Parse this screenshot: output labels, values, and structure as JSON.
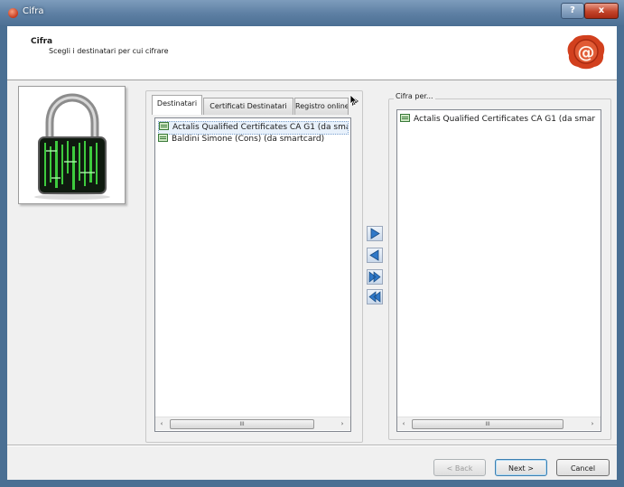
{
  "window": {
    "title": "Cifra"
  },
  "titlebar": {
    "help_label": "?",
    "close_label": "x"
  },
  "header": {
    "title": "Cifra",
    "subtitle": "Scegli i destinatari per cui cifrare",
    "seal_text": "@"
  },
  "tabs": [
    {
      "label": "Destinatari",
      "active": true
    },
    {
      "label": "Certificati Destinatari",
      "active": false
    },
    {
      "label": "Registro online",
      "active": false
    }
  ],
  "recipients_list": {
    "items": [
      {
        "label": "Actalis Qualified Certificates CA G1 (da sma",
        "selected": true
      },
      {
        "label": "Baldini Simone (Cons) (da smartcard)",
        "selected": false
      }
    ]
  },
  "move_buttons": [
    "add-arrow-icon",
    "remove-arrow-icon",
    "add-all-arrow-icon",
    "remove-all-arrow-icon"
  ],
  "encrypt_for": {
    "label": "Cifra per...",
    "items": [
      {
        "label": "Actalis Qualified Certificates CA G1 (da smar"
      }
    ]
  },
  "scrollbar": {
    "left_arrow": "‹",
    "right_arrow": "›",
    "thumb_grip": "III"
  },
  "footer": {
    "back_label": "< Back",
    "next_label": "Next >",
    "cancel_label": "Cancel"
  },
  "colors": {
    "titlebar": "#5d7fa3",
    "close": "#c3442a",
    "seal": "#d2401e",
    "selection": "#e8f1fb"
  }
}
